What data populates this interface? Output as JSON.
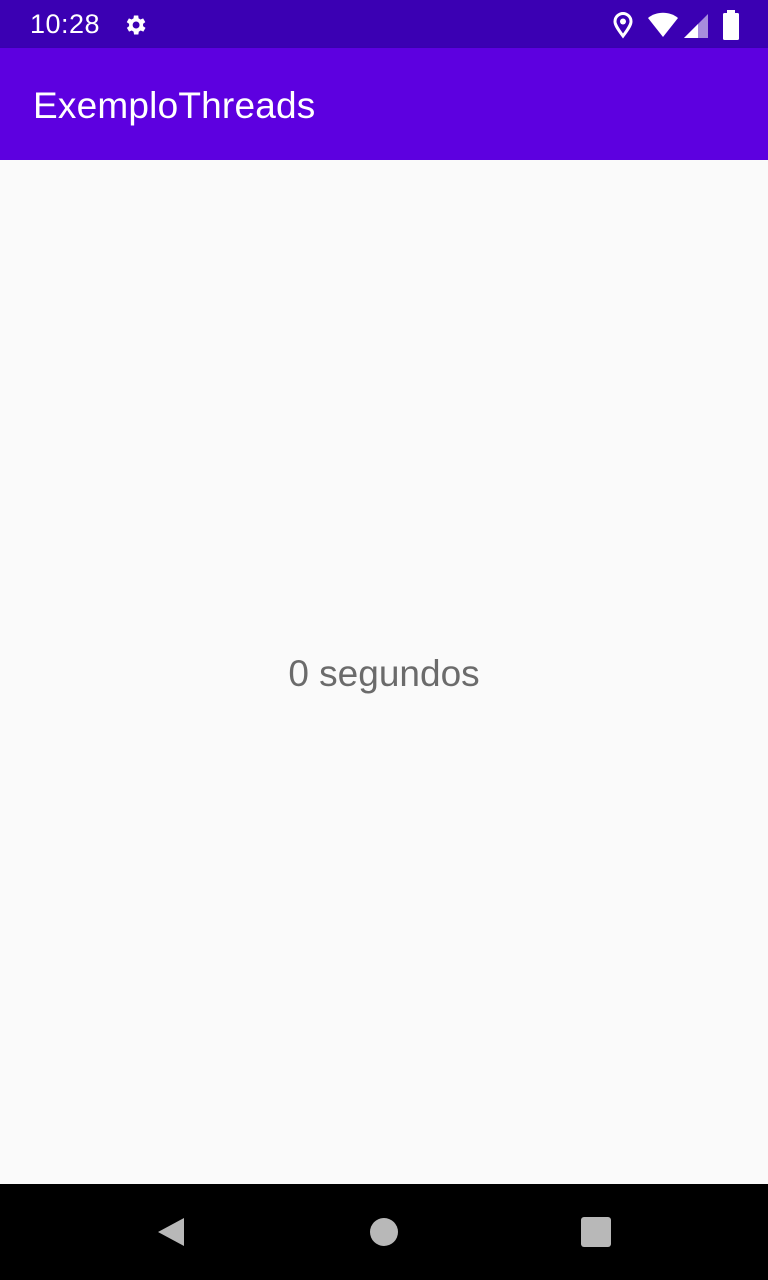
{
  "status_bar": {
    "time": "10:28",
    "icons": [
      "settings-gear-icon",
      "location-pin-icon",
      "wifi-icon",
      "cell-signal-icon",
      "battery-icon"
    ],
    "background": "#3b00b3"
  },
  "app_bar": {
    "title": "ExemploThreads",
    "background": "#5d00e0"
  },
  "main": {
    "counter_text": "0 segundos"
  },
  "nav_bar": {
    "buttons": [
      "back-icon",
      "home-icon",
      "recents-icon"
    ]
  }
}
